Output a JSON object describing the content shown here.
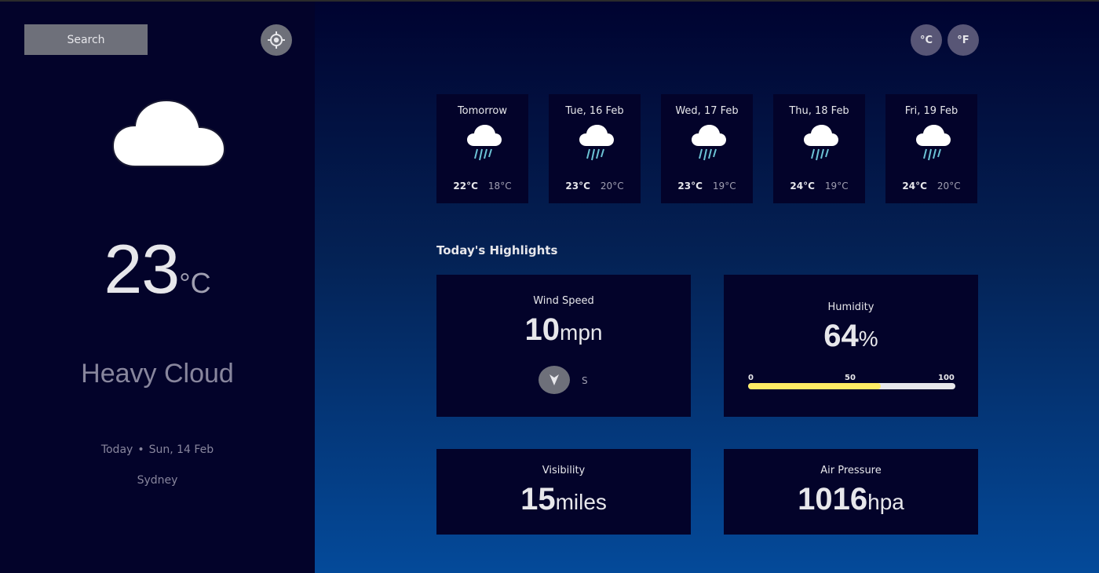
{
  "sidebar": {
    "search_label": "Search",
    "location_icon": "crosshair-icon",
    "current_icon": "heavy-cloud-icon",
    "temperature": "23",
    "temperature_unit": "°C",
    "condition": "Heavy Cloud",
    "date_prefix": "Today",
    "date_sep": "•",
    "date": "Sun, 14 Feb",
    "location": "Sydney"
  },
  "units": {
    "celsius": "°C",
    "fahrenheit": "°F"
  },
  "forecast": [
    {
      "day": "Tomorrow",
      "high": "22°C",
      "low": "18°C",
      "icon": "heavy-rain-icon"
    },
    {
      "day": "Tue, 16 Feb",
      "high": "23°C",
      "low": "20°C",
      "icon": "heavy-rain-icon"
    },
    {
      "day": "Wed, 17 Feb",
      "high": "23°C",
      "low": "19°C",
      "icon": "heavy-rain-icon"
    },
    {
      "day": "Thu, 18 Feb",
      "high": "24°C",
      "low": "19°C",
      "icon": "heavy-rain-icon"
    },
    {
      "day": "Fri, 19 Feb",
      "high": "24°C",
      "low": "20°C",
      "icon": "heavy-rain-icon"
    }
  ],
  "highlights": {
    "title": "Today's Highlights",
    "wind": {
      "label": "Wind Speed",
      "value": "10",
      "unit": "mpn",
      "direction": "S",
      "icon": "navigation-arrow-icon"
    },
    "humidity": {
      "label": "Humidity",
      "value": "64",
      "unit": "%",
      "percent": 64,
      "scale": [
        "0",
        "50",
        "100"
      ]
    },
    "visibility": {
      "label": "Visibility",
      "value": "15",
      "unit": "miles"
    },
    "pressure": {
      "label": "Air Pressure",
      "value": "1016",
      "unit": "hpa"
    }
  },
  "colors": {
    "sidebar_bg": "#03032a",
    "card_bg": "#03032a",
    "accent_yellow": "#ffec65",
    "muted_text": "#88869d"
  }
}
